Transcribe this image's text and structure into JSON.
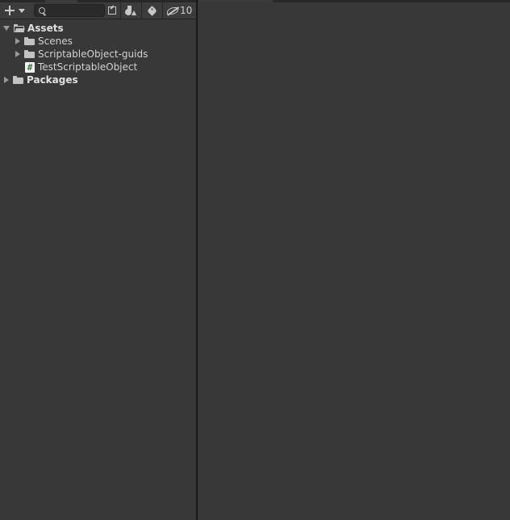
{
  "toolbar": {
    "create_icon": "plus-icon",
    "search": {
      "value": "",
      "placeholder": ""
    },
    "hidden_packages_count": "10"
  },
  "tree": {
    "assets": {
      "label": "Assets",
      "expanded": true,
      "children": [
        {
          "label": "Scenes",
          "type": "folder"
        },
        {
          "label": "ScriptableObject-guids",
          "type": "folder"
        },
        {
          "label": "TestScriptableObject",
          "type": "script"
        }
      ]
    },
    "packages": {
      "label": "Packages",
      "expanded": false
    }
  },
  "colors": {
    "background": "#383838",
    "toolbar": "#3c3c3c",
    "divider": "#191919",
    "text": "#d2d2d2",
    "script_icon_hash": "#3a7a3a"
  }
}
